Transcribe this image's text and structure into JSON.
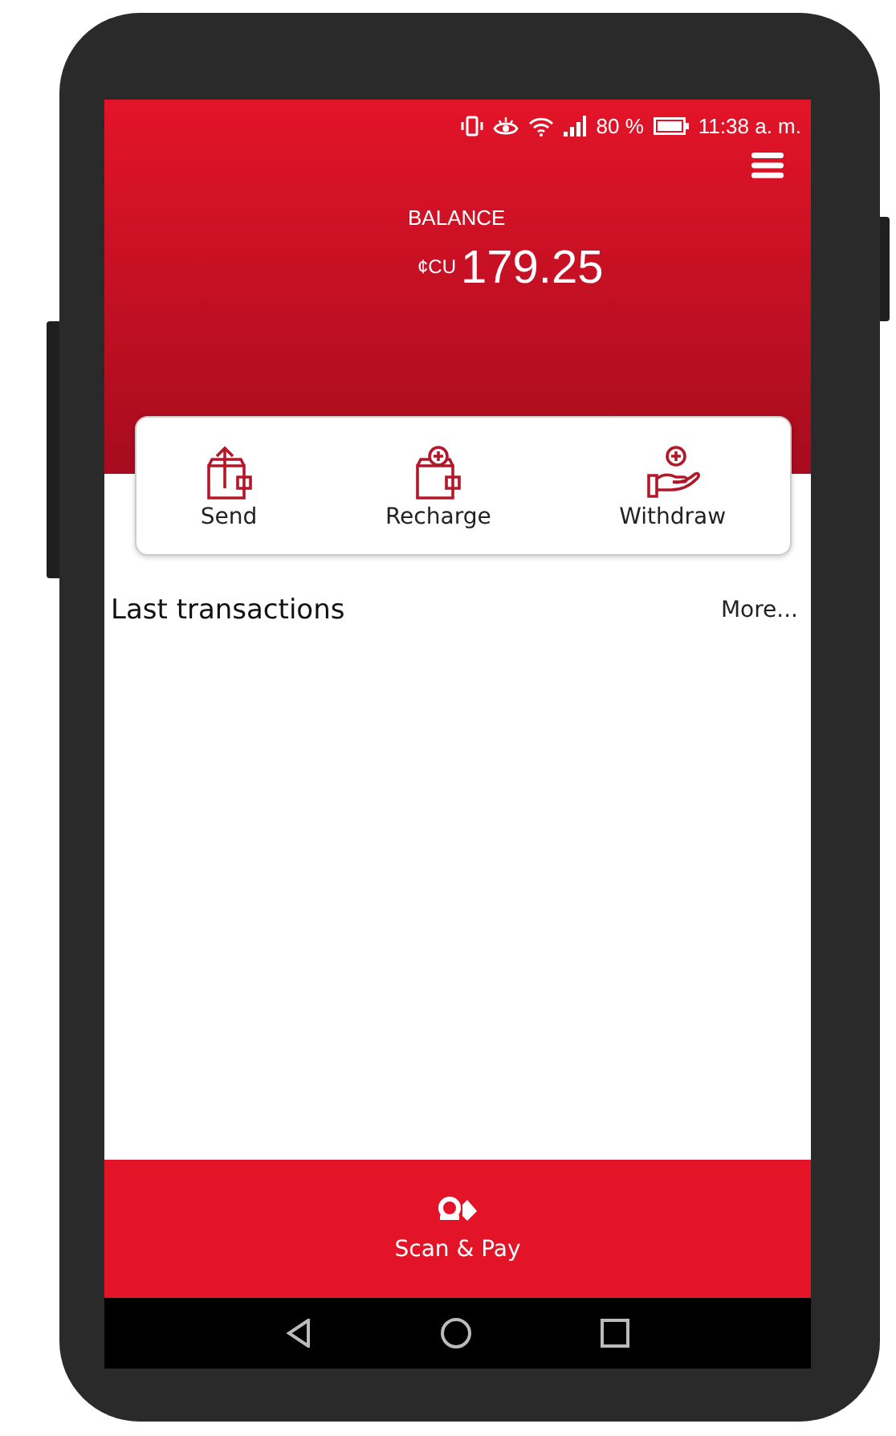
{
  "status_bar": {
    "battery": "80 %",
    "time": "11:38 a. m."
  },
  "balance": {
    "label": "BALANCE",
    "currency": "¢CU",
    "amount": "179.25"
  },
  "actions": [
    {
      "kind": "send",
      "label": "Send"
    },
    {
      "kind": "recharge",
      "label": "Recharge"
    },
    {
      "kind": "withdraw",
      "label": "Withdraw"
    }
  ],
  "transactions": {
    "title": "Last transactions",
    "more": "More..."
  },
  "bottom_bar": {
    "label": "Scan & Pay"
  }
}
